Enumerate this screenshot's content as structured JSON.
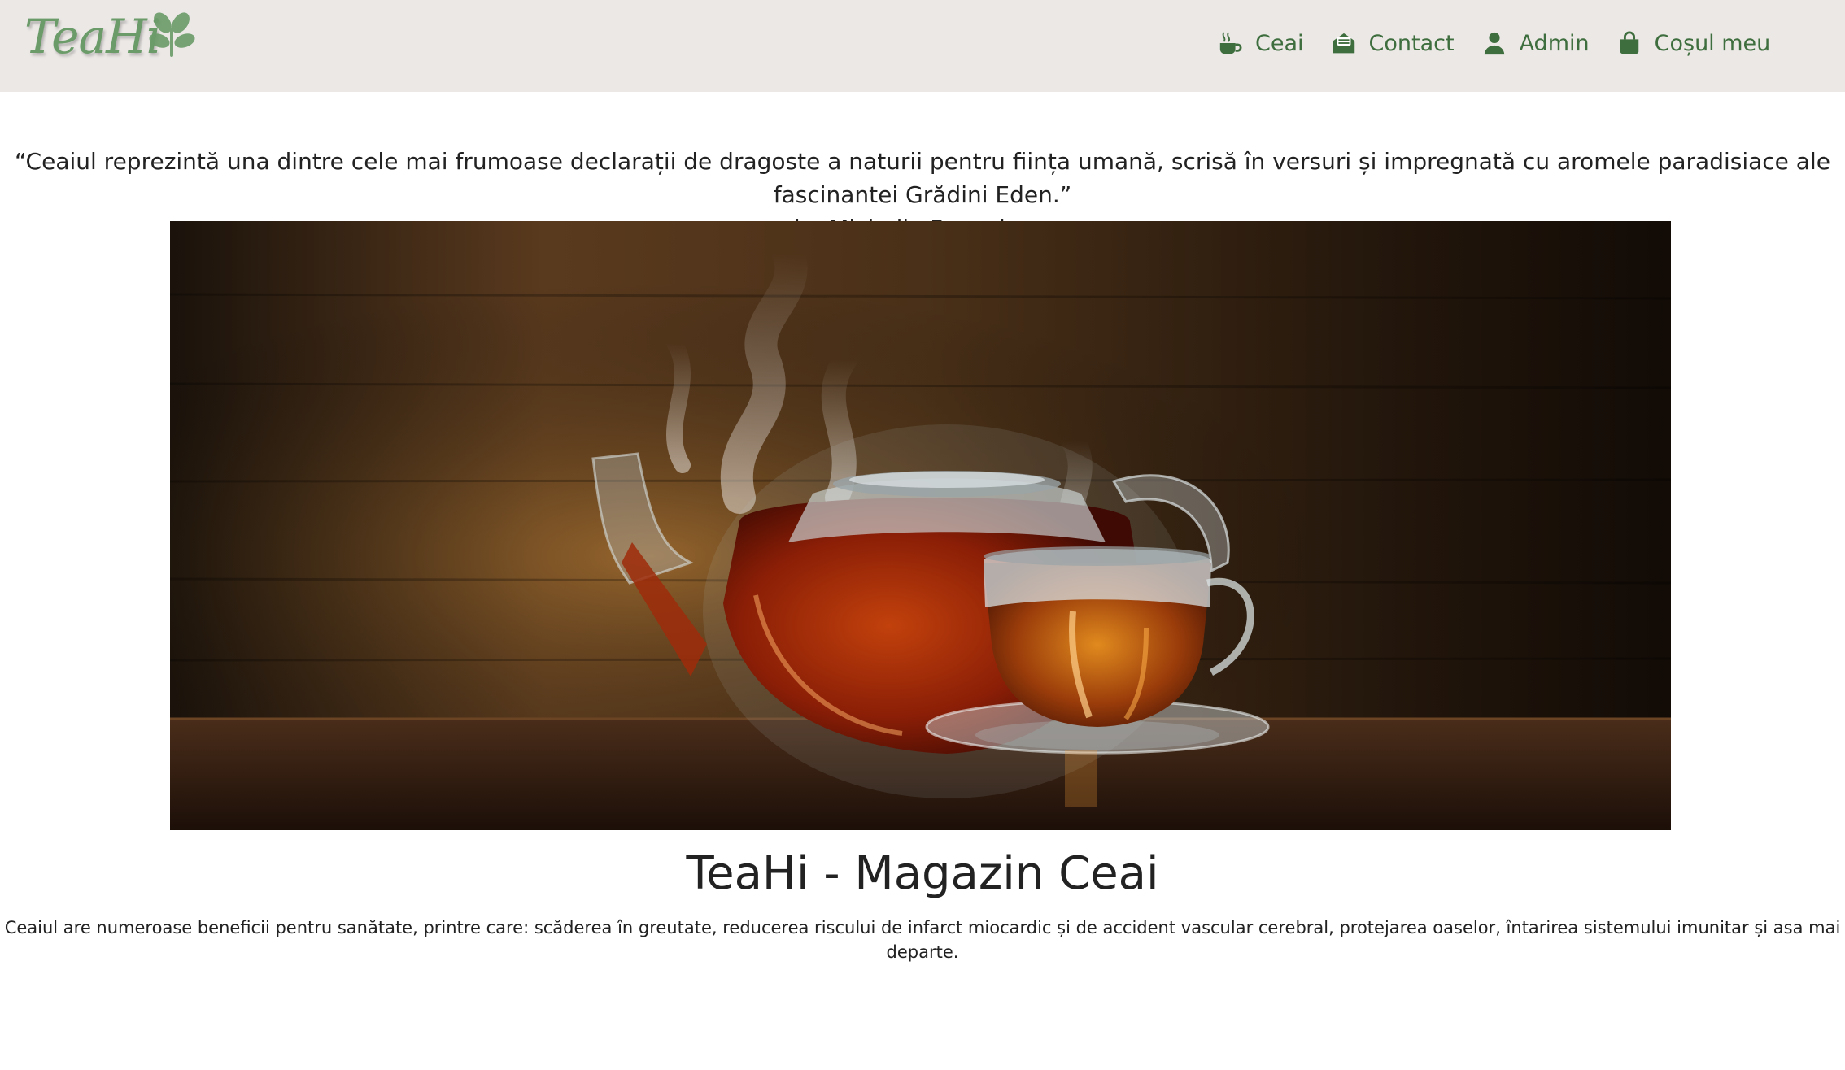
{
  "brand": {
    "logo_text": "TeaHi"
  },
  "nav": {
    "items": [
      {
        "label": "Ceai",
        "icon": "mug-hot-icon"
      },
      {
        "label": "Contact",
        "icon": "envelope-open-icon"
      },
      {
        "label": "Admin",
        "icon": "user-icon"
      },
      {
        "label": "Coșul meu",
        "icon": "shopping-bag-icon"
      }
    ]
  },
  "quote": {
    "text": "“Ceaiul reprezintă una dintre cele mai frumoase declarații de dragoste a naturii pentru ființa umană, scrisă în versuri și impregnată cu aromele paradisiace ale fascinantei Grădini Eden.”",
    "author": "by Michelle Rosenberg"
  },
  "hero": {
    "image": "teapot-and-teacup-photo"
  },
  "main": {
    "title": "TeaHi - Magazin Ceai",
    "description": "Ceaiul are numeroase beneficii pentru sanătate, printre care: scăderea în greutate, reducerea riscului de infarct miocardic și de accident vascular cerebral, protejarea oaselor, întarirea sistemului imunitar și asa mai departe."
  },
  "colors": {
    "navbar_bg": "#ebe8e6",
    "nav_link": "#3f6e3e",
    "logo": "#6a9b68",
    "text": "#222222"
  }
}
